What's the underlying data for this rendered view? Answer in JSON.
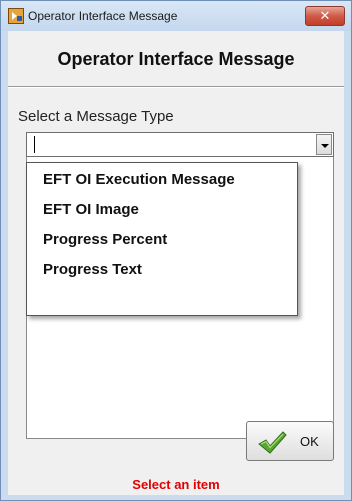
{
  "window": {
    "title": "Operator Interface Message",
    "close_glyph": "✕"
  },
  "heading": "Operator Interface Message",
  "select": {
    "label": "Select a Message Type",
    "value": "",
    "options": [
      "EFT OI Execution Message",
      "EFT OI Image",
      "Progress Percent",
      "Progress Text"
    ]
  },
  "ok_button": {
    "label": "OK",
    "icon": "checkmark-icon"
  },
  "status": {
    "text": "Select an item",
    "color": "#e00000"
  }
}
